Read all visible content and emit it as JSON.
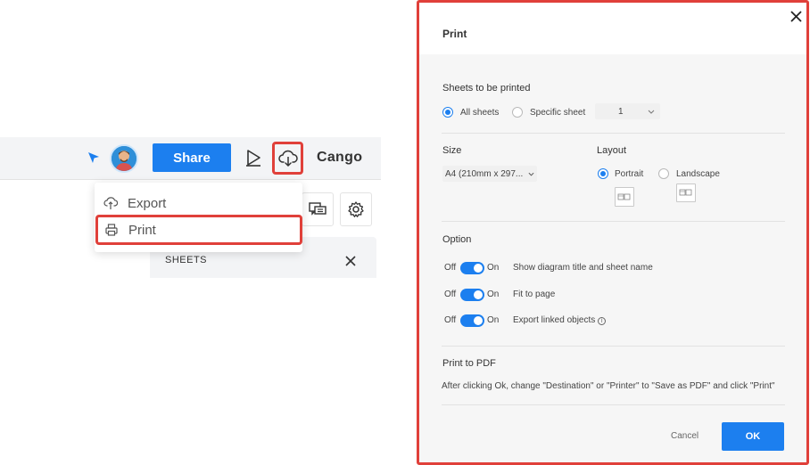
{
  "toolbar": {
    "share_label": "Share",
    "brand": "Cango"
  },
  "menu": {
    "items": [
      {
        "label": "Export",
        "icon": "cloud-upload-icon"
      },
      {
        "label": "Print",
        "icon": "printer-icon"
      }
    ]
  },
  "sheets_panel": {
    "label": "SHEETS"
  },
  "dialog": {
    "title": "Print",
    "sheets_section": "Sheets to be printed",
    "all_sheets": "All sheets",
    "specific_sheet": "Specific sheet",
    "sheet_number": "1",
    "size_section": "Size",
    "size_value": "A4 (210mm x 297...",
    "layout_section": "Layout",
    "portrait": "Portrait",
    "landscape": "Landscape",
    "option_section": "Option",
    "toggle_off": "Off",
    "toggle_on": "On",
    "options": [
      {
        "label": "Show diagram title and sheet name",
        "enabled": true
      },
      {
        "label": "Fit to page",
        "enabled": true
      },
      {
        "label": "Export linked objects",
        "enabled": true
      }
    ],
    "pdf_section": "Print to PDF",
    "pdf_note": "After clicking Ok, change \"Destination\" or \"Printer\" to \"Save as PDF\" and click \"Print\"",
    "cancel_label": "Cancel",
    "ok_label": "OK"
  },
  "colors": {
    "accent": "#1c7fef",
    "highlight": "#e0403a"
  }
}
